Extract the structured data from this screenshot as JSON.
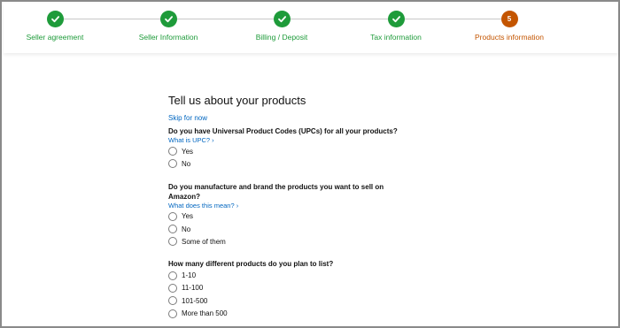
{
  "stepper": {
    "steps": [
      {
        "label": "Seller agreement",
        "status": "done"
      },
      {
        "label": "Seller Information",
        "status": "done"
      },
      {
        "label": "Billing / Deposit",
        "status": "done"
      },
      {
        "label": "Tax information",
        "status": "done"
      },
      {
        "label": "Products information",
        "status": "current",
        "number": "5"
      }
    ],
    "colors": {
      "done": "#1e9b3a",
      "current": "#c45500"
    }
  },
  "form": {
    "heading": "Tell us about your products",
    "skip_label": "Skip for now",
    "questions": [
      {
        "text": "Do you have Universal Product Codes (UPCs) for all your products?",
        "help": "What is UPC? ›",
        "options": [
          "Yes",
          "No"
        ]
      },
      {
        "text": "Do you manufacture and brand the products you want to sell on Amazon?",
        "help": "What does this mean? ›",
        "options": [
          "Yes",
          "No",
          "Some of them"
        ]
      },
      {
        "text": "How many different products do you plan to list?",
        "help": "",
        "options": [
          "1-10",
          "11-100",
          "101-500",
          "More than 500"
        ]
      }
    ],
    "link_color": "#0066c0"
  }
}
